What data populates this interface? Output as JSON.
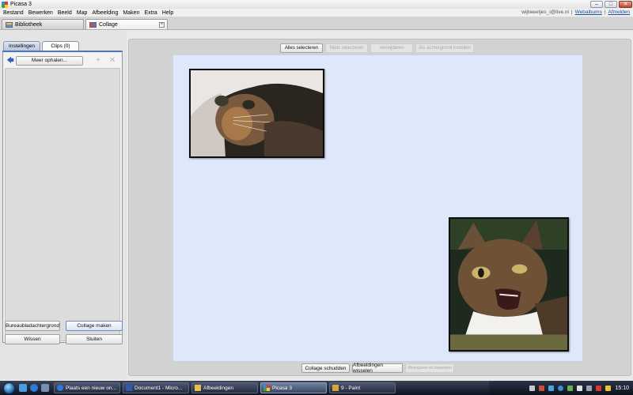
{
  "window": {
    "title": "Picasa 3"
  },
  "menu": [
    "Bestand",
    "Bewerken",
    "Beeld",
    "Map",
    "Afbeelding",
    "Maken",
    "Extra",
    "Help"
  ],
  "account": {
    "email": "wijtweetjes_i@live.nl",
    "separator": "|",
    "web_albums": "Webalbums",
    "sign_out": "Afmelden"
  },
  "tabs": [
    {
      "label": "Bibliotheek"
    },
    {
      "label": "Collage"
    }
  ],
  "left_panel": {
    "tabs": [
      "Instellingen",
      "Clips (0)"
    ],
    "get_more": "Meer ophalen...",
    "buttons": {
      "wallpaper": "Bureaubladachtergrond",
      "make_collage": "Collage maken",
      "clear": "Wissen",
      "close": "Sluiten"
    }
  },
  "toolbar_top": [
    "Alles selecteren",
    "Niets selecteren",
    "Verwijderen",
    "Als achtergrond instellen"
  ],
  "toolbar_bottom": [
    "Collage schudden",
    "Afbeeldingen wisselen",
    "Weergaven en bewerken"
  ],
  "taskbar": {
    "items": [
      {
        "label": "Plaats een nieuw on..."
      },
      {
        "label": "Document1 - Micro..."
      },
      {
        "label": "Afbeeldingen"
      },
      {
        "label": "Picasa 3"
      },
      {
        "label": "9 - Paint"
      }
    ],
    "clock": "15:10"
  }
}
